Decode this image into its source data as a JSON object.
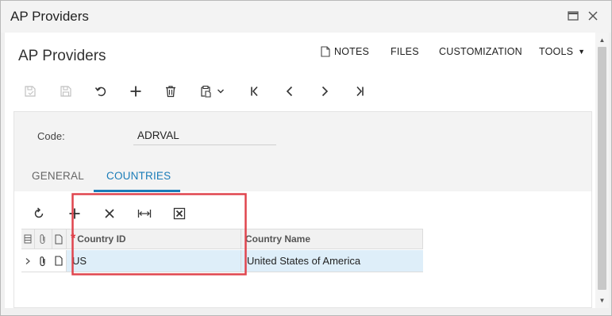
{
  "window": {
    "title": "AP Providers"
  },
  "page": {
    "title": "AP Providers"
  },
  "top_menu": {
    "notes": "NOTES",
    "files": "FILES",
    "customization": "CUSTOMIZATION",
    "tools": "TOOLS"
  },
  "toolbar": {
    "icons": [
      "save-close-icon",
      "save-icon",
      "undo-icon",
      "add-icon",
      "delete-icon",
      "copy-paste-icon",
      "first-record-icon",
      "previous-record-icon",
      "next-record-icon",
      "last-record-icon"
    ]
  },
  "form": {
    "code_label": "Code:",
    "code_value": "ADRVAL"
  },
  "tabs": [
    {
      "label": "GENERAL",
      "active": false
    },
    {
      "label": "COUNTRIES",
      "active": true
    }
  ],
  "grid": {
    "toolbar_icons": [
      "refresh-icon",
      "add-row-icon",
      "delete-row-icon",
      "fit-columns-icon",
      "export-excel-icon"
    ],
    "columns": [
      {
        "label": "Country ID",
        "required": true
      },
      {
        "label": "Country Name",
        "required": false
      }
    ],
    "rows": [
      {
        "country_id": "US",
        "country_name": "United States of America"
      }
    ]
  },
  "colors": {
    "accent": "#1a7cb8",
    "highlight_border": "#e0454e",
    "selected_row": "#deeef9",
    "required": "#d9303a"
  }
}
